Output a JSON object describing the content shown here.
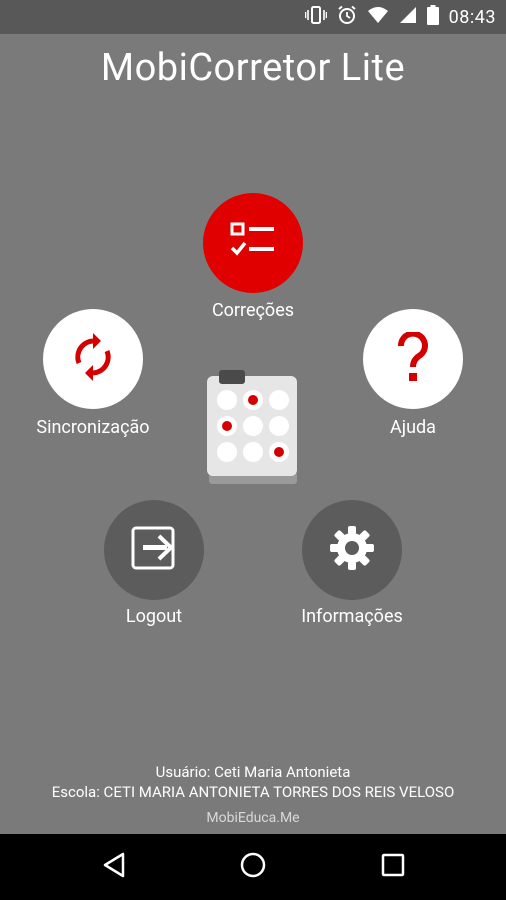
{
  "status_bar": {
    "time": "08:43",
    "icons": [
      "vibrate-icon",
      "alarm-icon",
      "wifi-icon",
      "signal-icon",
      "battery-icon"
    ]
  },
  "app": {
    "title": "MobiCorretor Lite",
    "accent_color": "#e00000",
    "background_color": "#7a7a7a"
  },
  "menu": {
    "correcoes": {
      "label": "Correções",
      "icon": "checklist-icon"
    },
    "sincronizacao": {
      "label": "Sincronização",
      "icon": "sync-icon"
    },
    "ajuda": {
      "label": "Ajuda",
      "icon": "help-icon"
    },
    "logout": {
      "label": "Logout",
      "icon": "logout-icon"
    },
    "informacoes": {
      "label": "Informações",
      "icon": "gear-icon"
    }
  },
  "footer": {
    "user": "Usuário: Ceti Maria Antonieta",
    "school": "Escola: CETI MARIA ANTONIETA TORRES DOS REIS VELOSO",
    "brand": "MobiEduca.Me"
  },
  "nav_bar": {
    "buttons": [
      "back-icon",
      "home-icon",
      "recents-icon"
    ]
  }
}
